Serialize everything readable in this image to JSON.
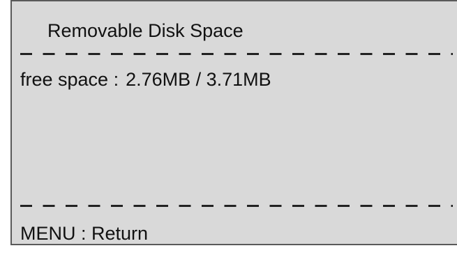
{
  "dialog": {
    "title": "Removable Disk Space",
    "free_space_label": "free space :",
    "free_space_value": "2.76MB / 3.71MB",
    "menu_hint": "MENU : Return"
  },
  "colors": {
    "screen_background": "#d9d9d9",
    "text": "#111111",
    "frame": "#5a5a5a"
  }
}
